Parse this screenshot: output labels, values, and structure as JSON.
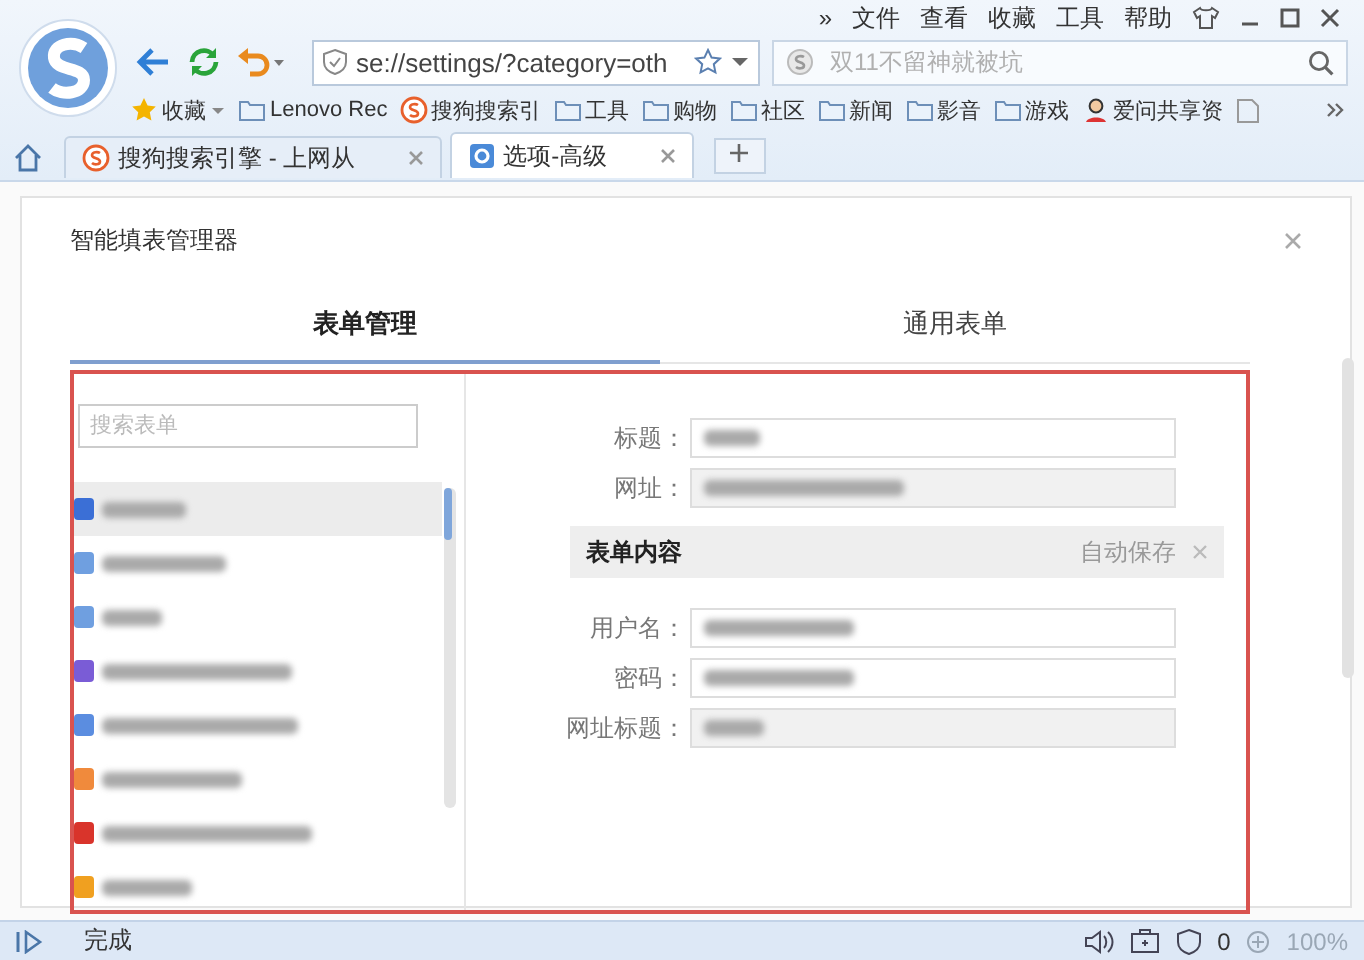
{
  "menu": [
    "»",
    "文件",
    "查看",
    "收藏",
    "工具",
    "帮助"
  ],
  "address": {
    "value": "se://settings/?category=oth"
  },
  "search": {
    "placeholder": "双11不留神就被坑"
  },
  "bookmarks": [
    {
      "label": "收藏",
      "kind": "star"
    },
    {
      "label": "Lenovo Rec",
      "kind": "folder"
    },
    {
      "label": "搜狗搜索引",
      "kind": "sogou"
    },
    {
      "label": "工具",
      "kind": "folder"
    },
    {
      "label": "购物",
      "kind": "folder"
    },
    {
      "label": "社区",
      "kind": "folder"
    },
    {
      "label": "新闻",
      "kind": "folder"
    },
    {
      "label": "影音",
      "kind": "folder"
    },
    {
      "label": "游戏",
      "kind": "folder"
    },
    {
      "label": "爱问共享资",
      "kind": "person"
    }
  ],
  "tabs": [
    {
      "label": "搜狗搜索引擎 - 上网从",
      "kind": "sogou",
      "selected": false
    },
    {
      "label": "选项-高级",
      "kind": "gear",
      "selected": true
    }
  ],
  "dialog": {
    "title": "智能填表管理器",
    "tabs": [
      {
        "label": "表单管理",
        "selected": true
      },
      {
        "label": "通用表单",
        "selected": false
      }
    ],
    "list_search": {
      "placeholder": "搜索表单"
    },
    "list": [
      {
        "selected": true,
        "color": "#3b6fd6"
      },
      {
        "selected": false,
        "color": "#6f9fe0"
      },
      {
        "selected": false,
        "color": "#6f9fe0"
      },
      {
        "selected": false,
        "color": "#7a5cd6"
      },
      {
        "selected": false,
        "color": "#5b8de0"
      },
      {
        "selected": false,
        "color": "#f08a3c"
      },
      {
        "selected": false,
        "color": "#d9342b"
      },
      {
        "selected": false,
        "color": "#f0a020"
      }
    ],
    "fields": [
      {
        "label": "标题：",
        "disabled": false
      },
      {
        "label": "网址：",
        "disabled": true
      }
    ],
    "section": {
      "title": "表单内容",
      "action": "自动保存"
    },
    "content_fields": [
      {
        "label": "用户名：",
        "disabled": false
      },
      {
        "label": "密码：",
        "disabled": false
      },
      {
        "label": "网址标题：",
        "disabled": true
      }
    ]
  },
  "status_bar": {
    "text": "完成",
    "count": "0",
    "zoom": "100%"
  }
}
